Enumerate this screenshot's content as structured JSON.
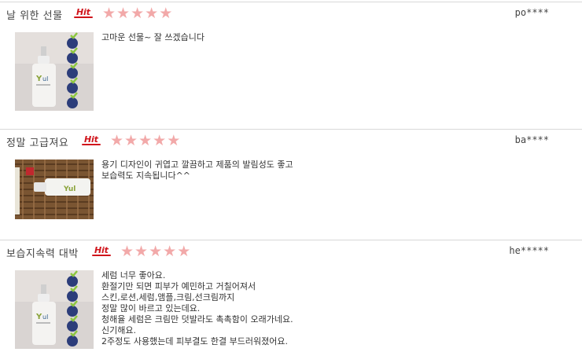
{
  "reviews": [
    {
      "title": "날 위한 선물",
      "badge": "Hit",
      "rating": 5,
      "user": "po****",
      "text": "고마운 선물~ 잘 쓰겠습니다",
      "image": "serum-bottle-certification-badges"
    },
    {
      "title": "정말 고급져요",
      "badge": "Hit",
      "rating": 5,
      "user": "ba****",
      "text": "용기 디자인이 귀엽고 깔끔하고 제품의 발림성도 좋고\n보습력도 지속됩니다^^",
      "image": "serum-bottle-on-wicker-basket"
    },
    {
      "title": "보습지속력 대박",
      "badge": "Hit",
      "rating": 5,
      "user": "he*****",
      "text": "세럼 너무 좋아요.\n환절기만 되면 피부가 예민하고 거칠어져서\n스킨,로션,세럼,앰플,크림,선크림까지\n정말 많이 바르고 있는데요.\n청해율 세럼은 크림만 덧발라도 촉촉함이 오래가네요.\n신기해요.\n2주정도 사용했는데 피부결도 한결 부드러워졌어요.",
      "image": "serum-bottle-certification-badges"
    }
  ]
}
